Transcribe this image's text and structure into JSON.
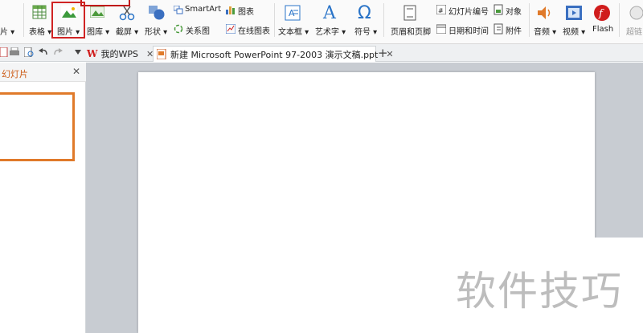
{
  "ribbon": {
    "left_partial": "片",
    "table_label": "表格",
    "picture_label": "图片",
    "gallery_label": "图库",
    "screenshot_label": "截屏",
    "shape_label": "形状",
    "smartart_label": "SmartArt",
    "chart_label": "图表",
    "relation_label": "关系图",
    "online_chart_label": "在线图表",
    "textbox_label": "文本框",
    "wordart_label": "艺术字",
    "symbol_label": "符号",
    "header_footer_label": "页眉和页脚",
    "slide_number_label": "幻灯片编号",
    "object_label": "对象",
    "datetime_label": "日期和时间",
    "attachment_label": "附件",
    "audio_label": "音频",
    "video_label": "视频",
    "flash_label": "Flash",
    "hyperlink_partial": "超链"
  },
  "tabs": {
    "home_label": "我的WPS",
    "doc_label": "新建 Microsoft PowerPoint 97-2003 演示文稿.ppt"
  },
  "panel": {
    "title": "幻灯片"
  },
  "watermark": "软件技巧"
}
